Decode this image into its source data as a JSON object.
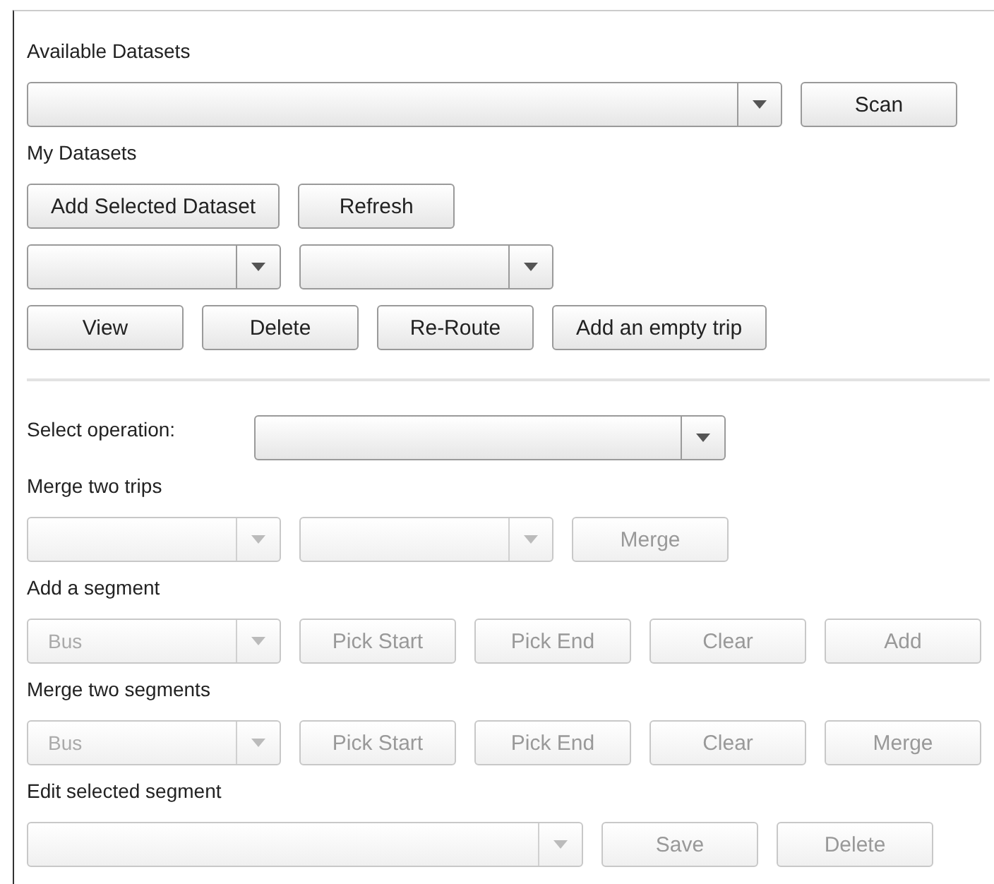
{
  "sections": [
    {
      "kind": "label",
      "text": "Available Datasets"
    },
    {
      "kind": "row",
      "items": [
        {
          "kind": "combo",
          "value": "",
          "disabled": false
        },
        {
          "kind": "button",
          "label": "Scan",
          "disabled": false
        }
      ]
    },
    {
      "kind": "label",
      "text": "My Datasets"
    },
    {
      "kind": "row",
      "items": [
        {
          "kind": "button",
          "label": "Add Selected Dataset",
          "disabled": false
        },
        {
          "kind": "button",
          "label": "Refresh",
          "disabled": false
        }
      ]
    },
    {
      "kind": "row",
      "items": [
        {
          "kind": "combo",
          "value": "",
          "disabled": false
        },
        {
          "kind": "combo",
          "value": "",
          "disabled": false
        }
      ]
    },
    {
      "kind": "row",
      "items": [
        {
          "kind": "button",
          "label": "View",
          "disabled": false
        },
        {
          "kind": "button",
          "label": "Delete",
          "disabled": false
        },
        {
          "kind": "button",
          "label": "Re-Route",
          "disabled": false
        },
        {
          "kind": "button",
          "label": "Add an empty trip",
          "disabled": false
        }
      ]
    },
    {
      "kind": "divider"
    },
    {
      "kind": "row",
      "items": [
        {
          "kind": "text",
          "text": "Select operation:"
        },
        {
          "kind": "combo",
          "value": "",
          "disabled": false
        }
      ]
    },
    {
      "kind": "label",
      "text": "Merge two trips"
    },
    {
      "kind": "row",
      "items": [
        {
          "kind": "combo",
          "value": "",
          "disabled": true
        },
        {
          "kind": "combo",
          "value": "",
          "disabled": true
        },
        {
          "kind": "button",
          "label": "Merge",
          "disabled": true
        }
      ]
    },
    {
      "kind": "label",
      "text": "Add a segment"
    },
    {
      "kind": "row",
      "items": [
        {
          "kind": "combo",
          "value": "Bus",
          "disabled": true
        },
        {
          "kind": "button",
          "label": "Pick Start",
          "disabled": true
        },
        {
          "kind": "button",
          "label": "Pick End",
          "disabled": true
        },
        {
          "kind": "button",
          "label": "Clear",
          "disabled": true
        },
        {
          "kind": "button",
          "label": "Add",
          "disabled": true
        }
      ]
    },
    {
      "kind": "label",
      "text": "Merge two segments"
    },
    {
      "kind": "row",
      "items": [
        {
          "kind": "combo",
          "value": "Bus",
          "disabled": true
        },
        {
          "kind": "button",
          "label": "Pick Start",
          "disabled": true
        },
        {
          "kind": "button",
          "label": "Pick End",
          "disabled": true
        },
        {
          "kind": "button",
          "label": "Clear",
          "disabled": true
        },
        {
          "kind": "button",
          "label": "Merge",
          "disabled": true
        }
      ]
    },
    {
      "kind": "label",
      "text": "Edit selected segment"
    },
    {
      "kind": "row",
      "items": [
        {
          "kind": "combo",
          "value": "",
          "disabled": true
        },
        {
          "kind": "button",
          "label": "Save",
          "disabled": true
        },
        {
          "kind": "button",
          "label": "Delete",
          "disabled": true
        }
      ]
    }
  ]
}
